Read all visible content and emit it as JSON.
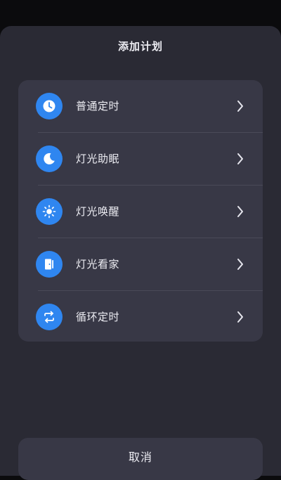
{
  "sheet": {
    "title": "添加计划"
  },
  "plan_options": [
    {
      "label": "普通定时",
      "icon": "clock-icon"
    },
    {
      "label": "灯光助眠",
      "icon": "moon-icon"
    },
    {
      "label": "灯光唤醒",
      "icon": "sun-icon"
    },
    {
      "label": "灯光看家",
      "icon": "door-icon"
    },
    {
      "label": "循环定时",
      "icon": "repeat-icon"
    }
  ],
  "cancel": {
    "label": "取消"
  },
  "colors": {
    "accent": "#2f86f0",
    "sheet_background": "#2a2a34",
    "card_background": "#383846",
    "text": "#ededf3"
  }
}
